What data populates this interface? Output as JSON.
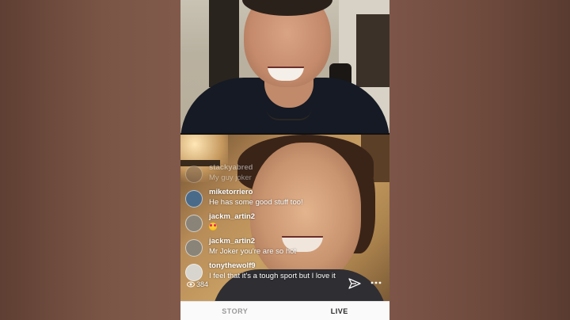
{
  "live": {
    "comments": [
      {
        "username": "stackyabred",
        "message": "My guy joker",
        "faded": true,
        "avatar_color": "#6b5a4e"
      },
      {
        "username": "miketorriero",
        "message": "He has some good stuff too!",
        "faded": false,
        "avatar_color": "#4a6a8a"
      },
      {
        "username": "jackm_artin2",
        "message": "",
        "emoji": "heart-eyes-emoji",
        "faded": false,
        "avatar_color": "#8a8478"
      },
      {
        "username": "jackm_artin2",
        "message": "Mr Joker you're are so hot",
        "faded": false,
        "avatar_color": "#8a8478"
      },
      {
        "username": "tonythewolf9",
        "message": "I feel that it's a tough sport but I love it",
        "faded": false,
        "avatar_color": "#d8d4ce"
      }
    ],
    "viewer_count": "384",
    "icons": {
      "viewers": "eye-icon",
      "send": "send-icon",
      "more": "more-icon"
    }
  },
  "bottom_tabs": [
    {
      "label": "STORY",
      "active": false
    },
    {
      "label": "LIVE",
      "active": true
    }
  ]
}
